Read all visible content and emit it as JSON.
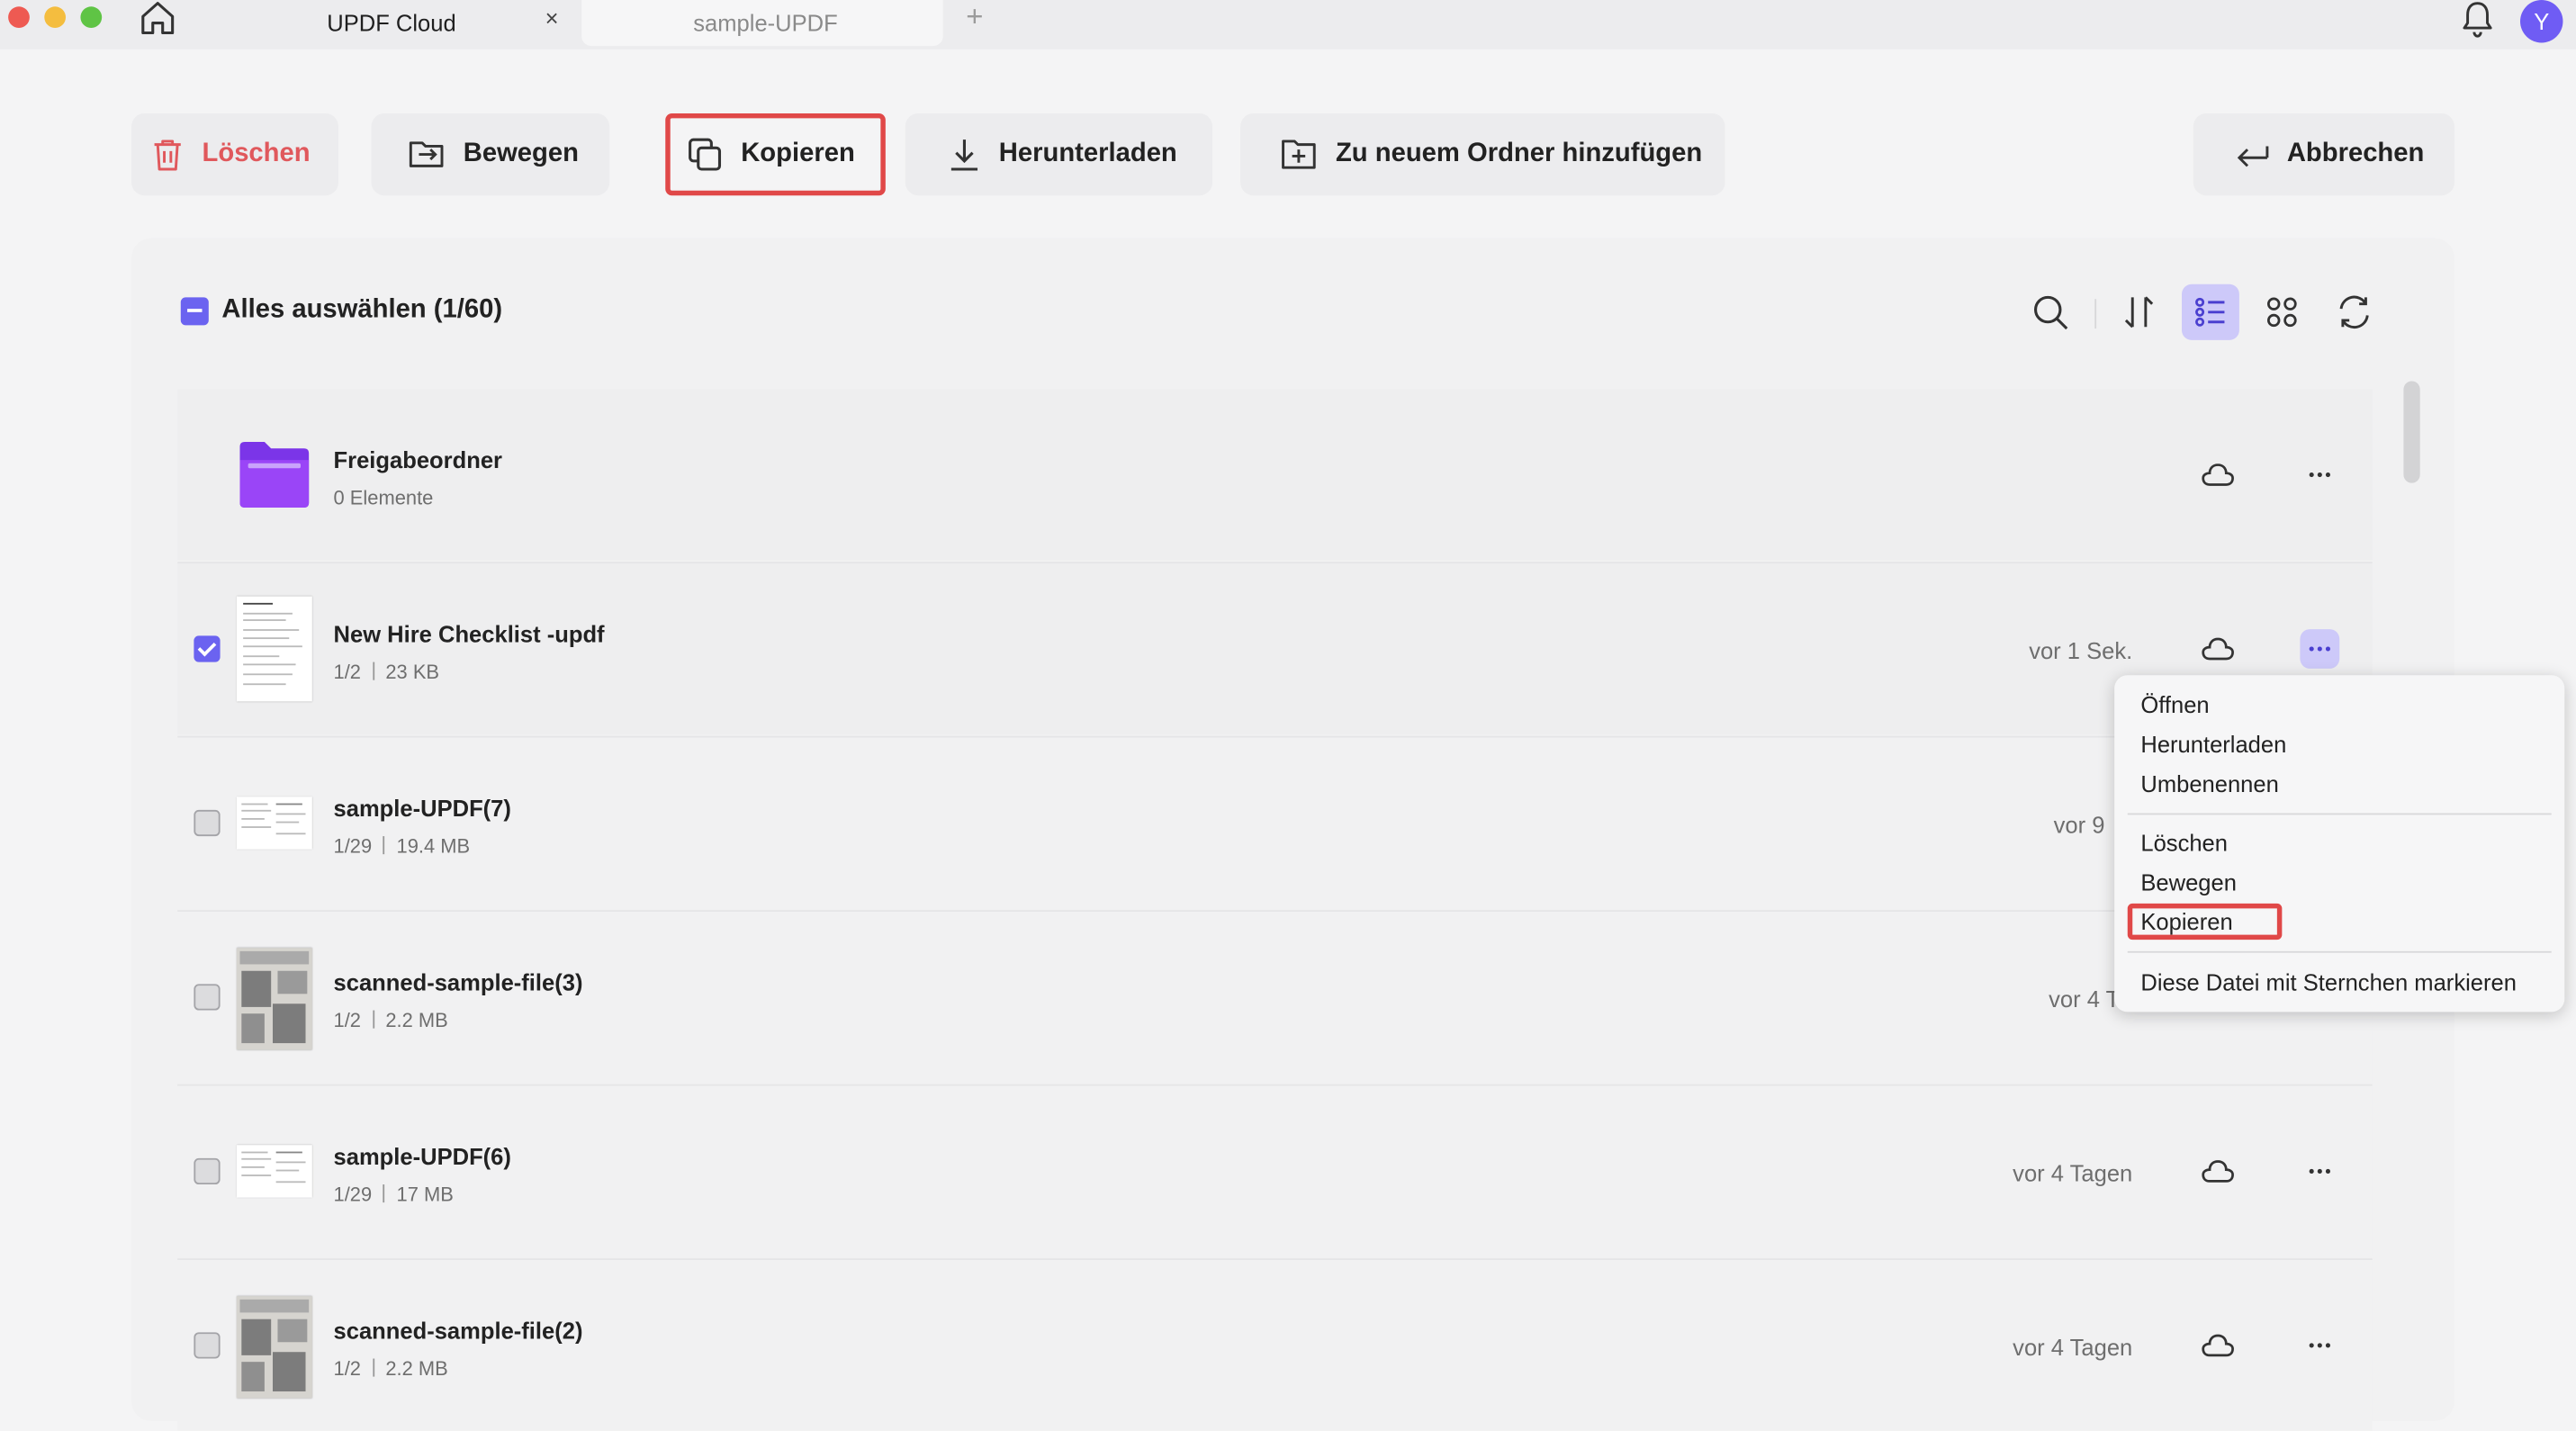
{
  "window": {
    "tabs": [
      {
        "label": "UPDF Cloud",
        "active": true
      },
      {
        "label": "sample-UPDF",
        "active": false
      }
    ],
    "new_tab_symbol": "+",
    "close_symbol": "×",
    "avatar_initial": "Y"
  },
  "toolbar": {
    "delete_label": "Löschen",
    "move_label": "Bewegen",
    "copy_label": "Kopieren",
    "download_label": "Herunterladen",
    "new_folder_label": "Zu neuem Ordner hinzufügen",
    "cancel_label": "Abbrechen"
  },
  "list_header": {
    "select_all_label": "Alles auswählen (1/60)"
  },
  "folder": {
    "name": "Freigabeordner",
    "meta": "0 Elemente"
  },
  "files": [
    {
      "name": "New Hire Checklist -updf",
      "pages": "1/2",
      "size": "23 KB",
      "time": "vor 1 Sek.",
      "checked": true
    },
    {
      "name": "sample-UPDF(7)",
      "pages": "1/29",
      "size": "19.4 MB",
      "time": "vor 9 ",
      "checked": false
    },
    {
      "name": "scanned-sample-file(3)",
      "pages": "1/2",
      "size": "2.2 MB",
      "time": "vor 4 T",
      "checked": false
    },
    {
      "name": "sample-UPDF(6)",
      "pages": "1/29",
      "size": "17 MB",
      "time": "vor 4 Tagen",
      "checked": false
    },
    {
      "name": "scanned-sample-file(2)",
      "pages": "1/2",
      "size": "2.2 MB",
      "time": "vor 4 Tagen",
      "checked": false
    }
  ],
  "context_menu": {
    "open": "Öffnen",
    "download": "Herunterladen",
    "rename": "Umbenennen",
    "delete": "Löschen",
    "move": "Bewegen",
    "copy": "Kopieren",
    "star": "Diese Datei mit Sternchen markieren"
  },
  "colors": {
    "accent": "#6b63f0",
    "danger": "#e0585c",
    "highlight_border": "#e04848",
    "folder": "#8b3ff0"
  }
}
